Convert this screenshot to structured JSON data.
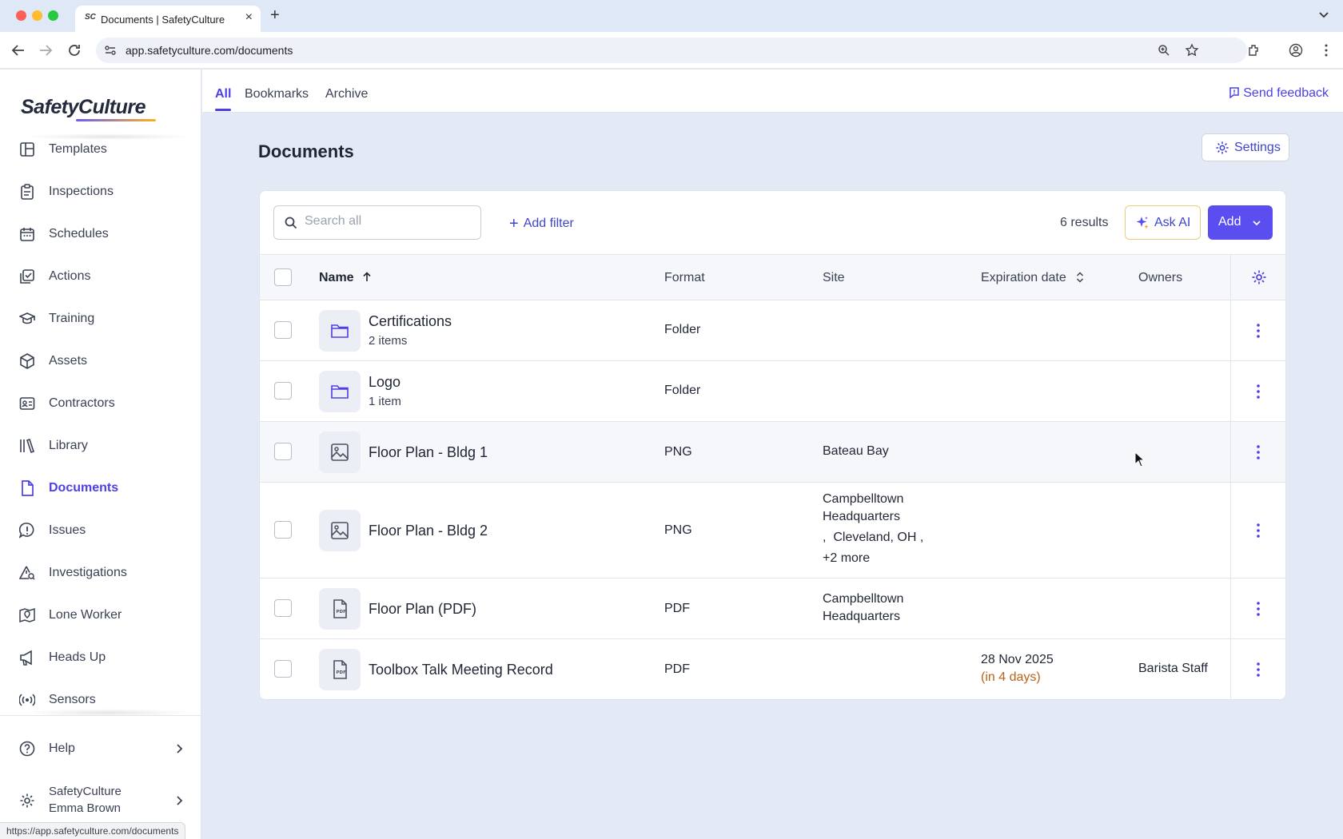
{
  "browser": {
    "tab_title": "Documents | SafetyCulture",
    "favicon_text": "SC",
    "url": "app.safetyculture.com/documents",
    "status_url": "https://app.safetyculture.com/documents"
  },
  "sidebar": {
    "logo": "SafetyCulture",
    "items": [
      {
        "label": "Templates",
        "icon": "templates-icon"
      },
      {
        "label": "Inspections",
        "icon": "clipboard-icon"
      },
      {
        "label": "Schedules",
        "icon": "calendar-icon"
      },
      {
        "label": "Actions",
        "icon": "checkbox-icon"
      },
      {
        "label": "Training",
        "icon": "graduation-cap-icon"
      },
      {
        "label": "Assets",
        "icon": "cube-icon"
      },
      {
        "label": "Contractors",
        "icon": "id-card-icon"
      },
      {
        "label": "Library",
        "icon": "books-icon"
      },
      {
        "label": "Documents",
        "icon": "document-icon",
        "active": true
      },
      {
        "label": "Issues",
        "icon": "alert-bubble-icon"
      },
      {
        "label": "Investigations",
        "icon": "warning-search-icon"
      },
      {
        "label": "Lone Worker",
        "icon": "map-pin-icon"
      },
      {
        "label": "Heads Up",
        "icon": "megaphone-icon"
      },
      {
        "label": "Sensors",
        "icon": "sensor-icon"
      }
    ],
    "help": "Help",
    "account": {
      "org": "SafetyCulture",
      "user": "Emma Brown"
    }
  },
  "top_tabs": {
    "all": "All",
    "bookmarks": "Bookmarks",
    "archive": "Archive",
    "feedback": "Send feedback"
  },
  "main": {
    "title": "Documents",
    "settings_label": "Settings",
    "search_placeholder": "Search all",
    "add_filter": "Add filter",
    "results": "6 results",
    "ask_ai": "Ask AI",
    "add": "Add",
    "columns": {
      "name": "Name",
      "format": "Format",
      "site": "Site",
      "expiration": "Expiration date",
      "owners": "Owners"
    },
    "rows": [
      {
        "name": "Certifications",
        "sub": "2 items",
        "format": "Folder",
        "site": "",
        "expiration": "",
        "expiration_note": "",
        "owners": "",
        "icon": "folder-icon"
      },
      {
        "name": "Logo",
        "sub": "1 item",
        "format": "Folder",
        "site": "",
        "expiration": "",
        "expiration_note": "",
        "owners": "",
        "icon": "folder-icon"
      },
      {
        "name": "Floor Plan - Bldg 1",
        "sub": "",
        "format": "PNG",
        "site": "Bateau Bay",
        "expiration": "",
        "expiration_note": "",
        "owners": "",
        "icon": "image-icon"
      },
      {
        "name": "Floor Plan - Bldg 2",
        "sub": "",
        "format": "PNG",
        "site_lines": [
          "Campbelltown",
          "Headquarters",
          ",  Cleveland, OH ,",
          "+2 more"
        ],
        "expiration": "",
        "expiration_note": "",
        "owners": "",
        "icon": "image-icon"
      },
      {
        "name": "Floor Plan (PDF)",
        "sub": "",
        "format": "PDF",
        "site_lines": [
          "Campbelltown",
          "Headquarters"
        ],
        "expiration": "",
        "expiration_note": "",
        "owners": "",
        "icon": "pdf-file-icon"
      },
      {
        "name": "Toolbox Talk Meeting Record",
        "sub": "",
        "format": "PDF",
        "site": "",
        "expiration": "28 Nov 2025",
        "expiration_note": "(in 4 days)",
        "owners": "Barista Staff",
        "icon": "pdf-file-icon"
      }
    ]
  },
  "colors": {
    "accent": "#4d40e6",
    "add_button": "#5b4ef0",
    "warning_text": "#b8641a",
    "page_bg": "#e3eaf6"
  }
}
